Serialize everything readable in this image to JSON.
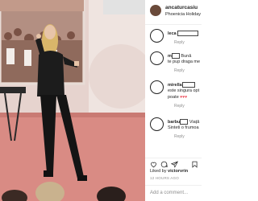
{
  "post": {
    "username": "ancaturcasiu",
    "location": "Phoenicia Holiday",
    "likes_prefix": "Liked by",
    "likes_user": "victorvrin",
    "timestamp": "12 HOURS AGO",
    "add_comment_placeholder": "Add a comment..."
  },
  "comments": [
    {
      "username": "leca",
      "text": "",
      "reply_label": "Reply"
    },
    {
      "username": "m",
      "text": "Bună",
      "text2": "te pup draga me",
      "reply_label": "Reply"
    },
    {
      "username": "mirella",
      "text": "",
      "text2": "este singura opt",
      "text3": "poate",
      "hearts": "♥♥♥",
      "reply_label": "Reply"
    },
    {
      "username": "barbu",
      "text": "Viață",
      "text2": "Sinteti o frumoa",
      "reply_label": "Reply"
    }
  ],
  "colors": {
    "stage_floor": "#d98b84",
    "backdrop": "#e9d4cf",
    "accent_like": "#ed4956"
  },
  "icons": [
    "heart-icon",
    "comment-icon",
    "share-icon",
    "bookmark-icon"
  ]
}
